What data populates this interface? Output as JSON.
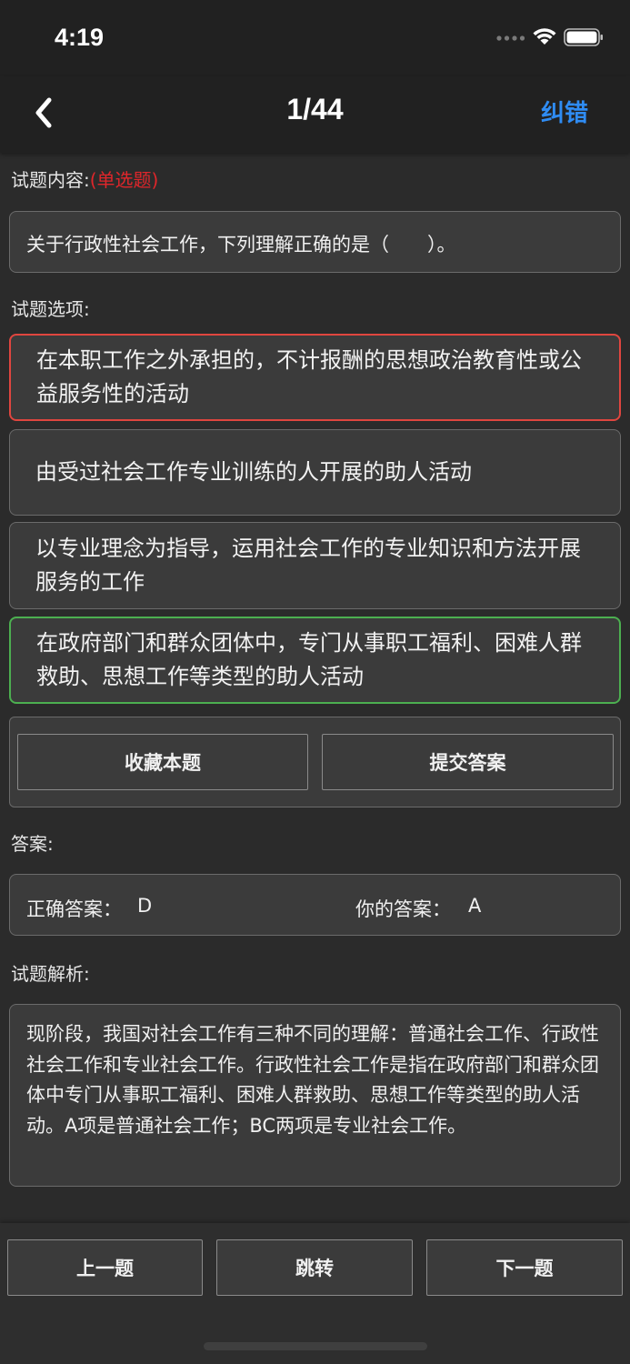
{
  "status_bar": {
    "time": "4:19",
    "signal_icon": "cellular-signal-icon",
    "wifi_icon": "wifi-icon",
    "battery_icon": "battery-icon"
  },
  "nav": {
    "back_icon": "chevron-left-icon",
    "title": "1/44",
    "report_label": "纠错",
    "report_color": "#2f8cf3"
  },
  "question": {
    "section_label": "试题内容:",
    "type_label": "(单选题)",
    "type_color": "#e0262b",
    "text": "关于行政性社会工作，下列理解正确的是（　　）。"
  },
  "options": {
    "section_label": "试题选项:",
    "items": [
      {
        "text": "在本职工作之外承担的，不计报酬的思想政治教育性或公益服务性的活动",
        "state": "wrong"
      },
      {
        "text": "由受过社会工作专业训练的人开展的助人活动",
        "state": "none"
      },
      {
        "text": "以专业理念为指导，运用社会工作的专业知识和方法开展服务的工作",
        "state": "none"
      },
      {
        "text": "在政府部门和群众团体中，专门从事职工福利、困难人群救助、思想工作等类型的助人活动",
        "state": "correct"
      }
    ],
    "wrong_border_color": "#e0463f",
    "correct_border_color": "#4caf50"
  },
  "actions": {
    "favorite_label": "收藏本题",
    "submit_label": "提交答案"
  },
  "answer": {
    "section_label": "答案:",
    "correct_label": "正确答案：",
    "correct_value": "D",
    "your_label": "你的答案：",
    "your_value": "A"
  },
  "analysis": {
    "section_label": "试题解析:",
    "text": "现阶段，我国对社会工作有三种不同的理解：普通社会工作、行政性社会工作和专业社会工作。行政性社会工作是指在政府部门和群众团体中专门从事职工福利、困难人群救助、思想工作等类型的助人活动。A项是普通社会工作；BC两项是专业社会工作。"
  },
  "bottom_nav": {
    "prev_label": "上一题",
    "jump_label": "跳转",
    "next_label": "下一题"
  }
}
